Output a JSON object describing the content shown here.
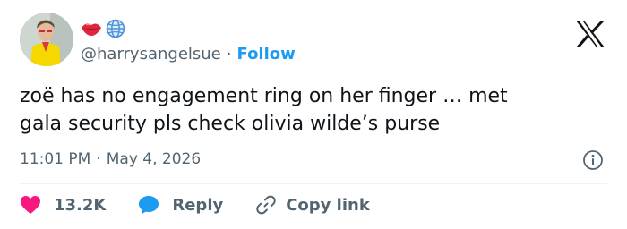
{
  "author": {
    "handle": "@harrysangelsue",
    "separator": "·",
    "follow_label": "Follow",
    "name_emojis": [
      "lips-icon",
      "globe-icon"
    ]
  },
  "brand": {
    "logo": "x-logo",
    "color": "#0f1419"
  },
  "tweet": {
    "text": "zoë has no engagement ring on her finger … met\ngala security pls check olivia wilde’s purse",
    "time": "11:01 PM",
    "separator": "·",
    "date": "May 4, 2026"
  },
  "actions": {
    "like_count": "13.2K",
    "reply_label": "Reply",
    "copy_link_label": "Copy link"
  },
  "colors": {
    "link_blue": "#1d9bf0",
    "like_red": "#f91880",
    "muted_text": "#536471",
    "divider": "#eff3f4"
  }
}
